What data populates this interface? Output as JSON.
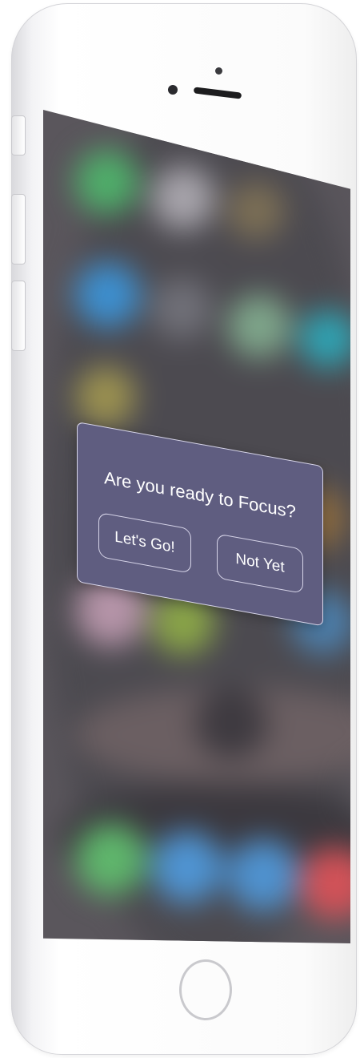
{
  "dialog": {
    "title": "Are you ready to Focus?",
    "primary_label": "Let's Go!",
    "secondary_label": "Not Yet"
  },
  "colors": {
    "dialog_background": "#5f5d80",
    "dialog_border": "#d8d6ea",
    "screen_background": "#5a565c"
  },
  "icons": [
    "camera-icon",
    "speaker-grille-icon",
    "home-button-icon"
  ]
}
